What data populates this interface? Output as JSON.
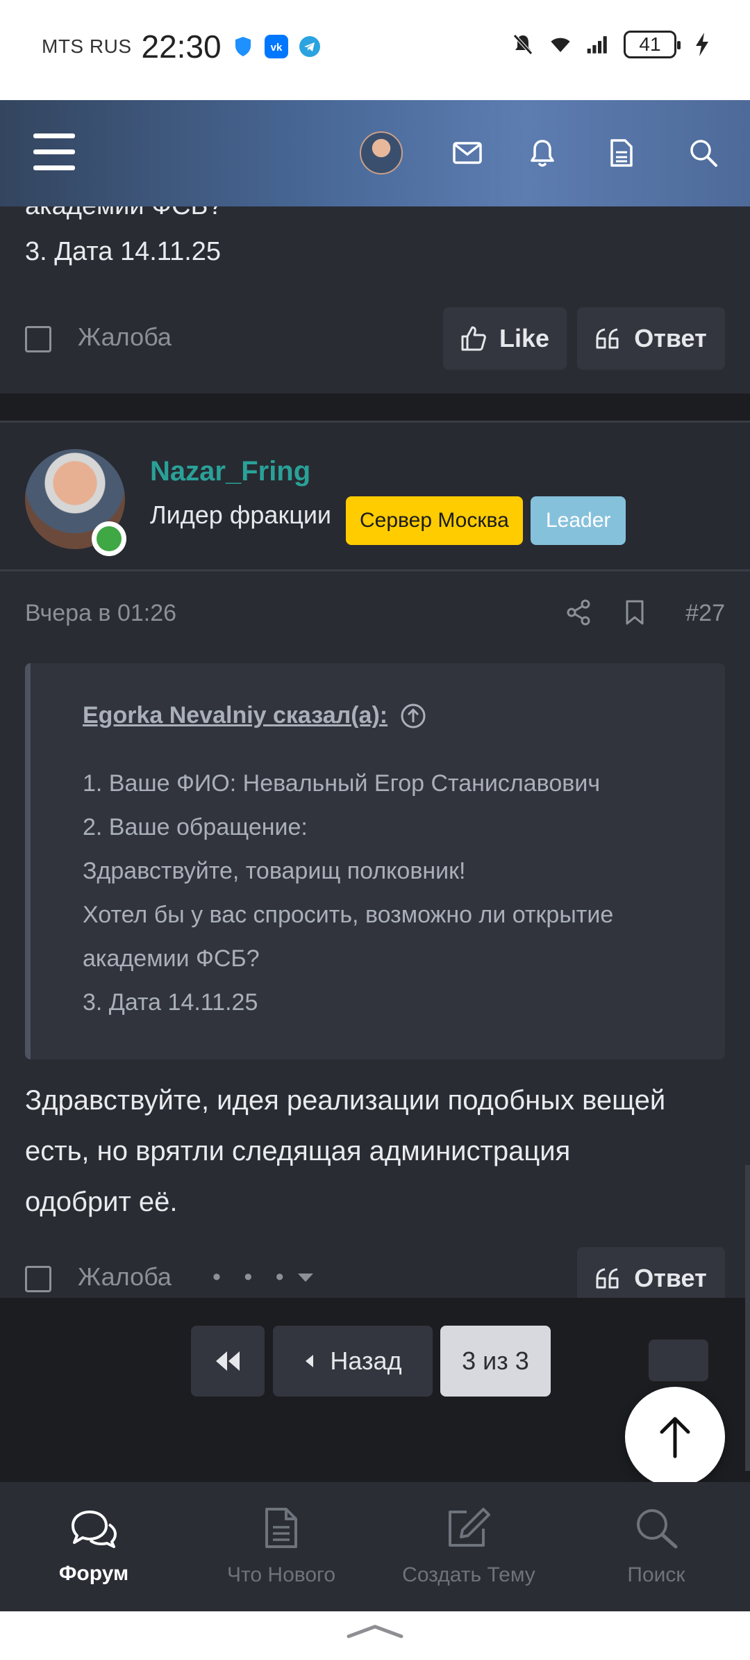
{
  "status_bar": {
    "carrier": "MTS RUS",
    "time": "22:30",
    "battery": "41"
  },
  "post_prev": {
    "partial_line": "академии ФСБ?",
    "line": "3. Дата 14.11.25",
    "report_label": "Жалоба",
    "like_label": "Like",
    "reply_label": "Ответ"
  },
  "post": {
    "username": "Nazar_Fring",
    "user_title": "Лидер фракции",
    "badge_server": "Сервер Москва",
    "badge_role": "Leader",
    "timestamp": "Вчера в 01:26",
    "post_number": "#27",
    "quote": {
      "author": "Egorka Nevalniy сказал(а):",
      "lines": [
        "1. Ваше ФИО: Невальный Егор Станиславович",
        "2. Ваше обращение:",
        "Здравствуйте, товарищ полковник!",
        "Хотел бы у вас спросить, возможно ли открытие",
        "академии ФСБ?",
        "3. Дата 14.11.25"
      ]
    },
    "body_lines": [
      "Здравствуйте, идея реализации подобных вещей",
      "есть, но врятли следящая администрация",
      "одобрит её."
    ],
    "report_label": "Жалоба",
    "reply_label": "Ответ"
  },
  "pagination": {
    "prev_label": "Назад",
    "current": "3 из 3"
  },
  "bottom_nav": [
    {
      "label": "Форум",
      "icon": "chat-bubbles-icon",
      "active": true
    },
    {
      "label": "Что Нового",
      "icon": "document-icon",
      "active": false
    },
    {
      "label": "Создать Тему",
      "icon": "edit-icon",
      "active": false
    },
    {
      "label": "Поиск",
      "icon": "search-icon",
      "active": false
    }
  ],
  "colors": {
    "header_gradient": [
      "#33455f",
      "#5d7cb0"
    ],
    "username": "#2aa198",
    "badge_server": "#ffcc00",
    "badge_leader": "#86c1dc",
    "online": "#3fa743"
  }
}
